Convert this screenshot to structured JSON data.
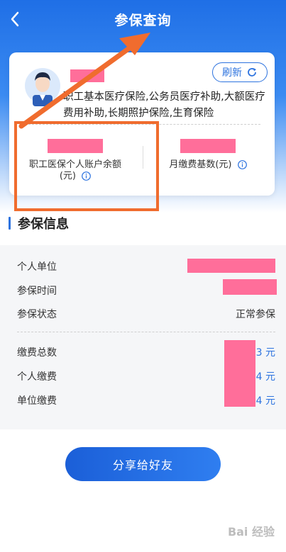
{
  "header": {
    "title": "参保查询"
  },
  "card": {
    "refresh_label": "刷新",
    "insured_types": "职工基本医疗保险,公务员医疗补助,大额医疗费用补助,长期照护保险,生育保险",
    "stats": [
      {
        "label": "职工医保个人账户余额(元)"
      },
      {
        "label": "月缴费基数(元)"
      }
    ]
  },
  "section": {
    "title": "参保信息"
  },
  "info": {
    "rows": [
      {
        "label": "个人单位"
      },
      {
        "label": "参保时间"
      },
      {
        "label": "参保状态",
        "value": "正常参保"
      },
      {
        "label": "缴费总数",
        "unit": "3 元"
      },
      {
        "label": "个人缴费",
        "unit": "4 元"
      },
      {
        "label": "单位缴费",
        "unit": "4 元"
      }
    ]
  },
  "share_label": "分享给好友",
  "watermark": "Bai 经验",
  "colors": {
    "primary": "#2d73df",
    "highlight": "#f06c2e",
    "redaction": "#ff6e9a"
  }
}
